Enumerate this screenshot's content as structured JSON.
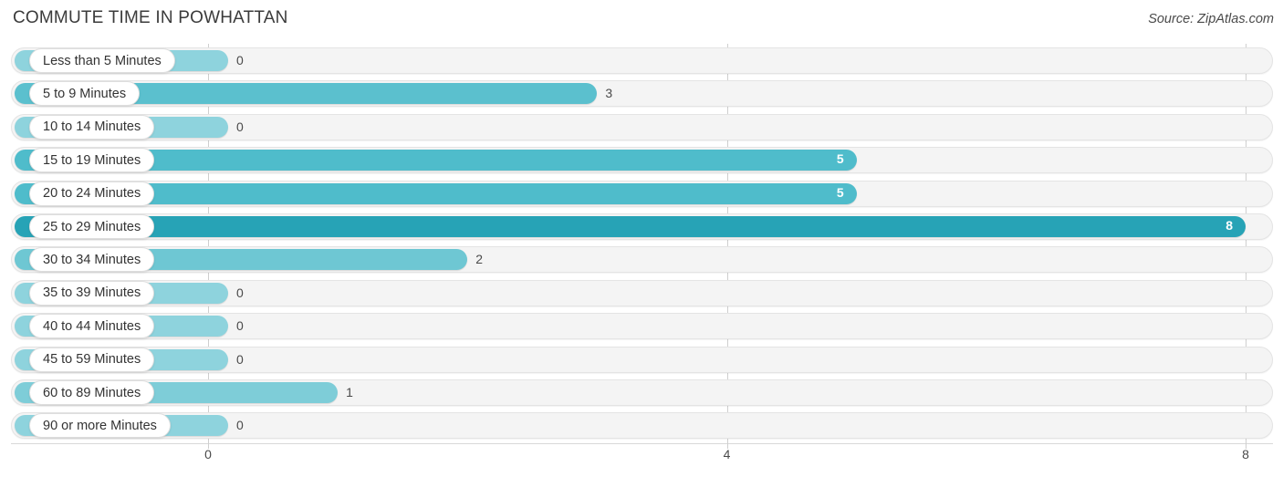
{
  "header": {
    "title": "COMMUTE TIME IN POWHATTAN",
    "source": "Source: ZipAtlas.com"
  },
  "chart_data": {
    "type": "bar",
    "orientation": "horizontal",
    "title": "COMMUTE TIME IN POWHATTAN",
    "xlabel": "",
    "ylabel": "",
    "xlim": [
      0,
      8
    ],
    "grid": true,
    "legend": "none",
    "xticks": [
      "0",
      "4",
      "8"
    ],
    "xtick_values": [
      0,
      4,
      8
    ],
    "categories": [
      "Less than 5 Minutes",
      "5 to 9 Minutes",
      "10 to 14 Minutes",
      "15 to 19 Minutes",
      "20 to 24 Minutes",
      "25 to 29 Minutes",
      "30 to 34 Minutes",
      "35 to 39 Minutes",
      "40 to 44 Minutes",
      "45 to 59 Minutes",
      "60 to 89 Minutes",
      "90 or more Minutes"
    ],
    "values": [
      0,
      3,
      0,
      5,
      5,
      8,
      2,
      0,
      0,
      0,
      1,
      0
    ],
    "value_labels": [
      "0",
      "3",
      "0",
      "5",
      "5",
      "8",
      "2",
      "0",
      "0",
      "0",
      "1",
      "0"
    ],
    "colors": {
      "zero": "#8ed3dd",
      "low": "#63c2d0",
      "mid": "#4fbccb",
      "high": "#27a3b6",
      "track": "#f4f4f4",
      "track_border": "#e4e4e4",
      "gridline": "#cfcfcf",
      "text": "#4a4a4a",
      "value_inside": "#ffffff"
    },
    "bars": [
      {
        "label": "Less than 5 Minutes",
        "value": 0,
        "value_label": "0",
        "color": "#8ed3dd",
        "inside": false
      },
      {
        "label": "5 to 9 Minutes",
        "value": 3,
        "value_label": "3",
        "color": "#5bc0ce",
        "inside": false
      },
      {
        "label": "10 to 14 Minutes",
        "value": 0,
        "value_label": "0",
        "color": "#8ed3dd",
        "inside": false
      },
      {
        "label": "15 to 19 Minutes",
        "value": 5,
        "value_label": "5",
        "color": "#4fbccb",
        "inside": true
      },
      {
        "label": "20 to 24 Minutes",
        "value": 5,
        "value_label": "5",
        "color": "#4fbccb",
        "inside": true
      },
      {
        "label": "25 to 29 Minutes",
        "value": 8,
        "value_label": "8",
        "color": "#27a3b6",
        "inside": true
      },
      {
        "label": "30 to 34 Minutes",
        "value": 2,
        "value_label": "2",
        "color": "#6ec7d3",
        "inside": false
      },
      {
        "label": "35 to 39 Minutes",
        "value": 0,
        "value_label": "0",
        "color": "#8ed3dd",
        "inside": false
      },
      {
        "label": "40 to 44 Minutes",
        "value": 0,
        "value_label": "0",
        "color": "#8ed3dd",
        "inside": false
      },
      {
        "label": "45 to 59 Minutes",
        "value": 0,
        "value_label": "0",
        "color": "#8ed3dd",
        "inside": false
      },
      {
        "label": "60 to 89 Minutes",
        "value": 1,
        "value_label": "1",
        "color": "#7ecdd8",
        "inside": false
      },
      {
        "label": "90 or more Minutes",
        "value": 0,
        "value_label": "0",
        "color": "#8ed3dd",
        "inside": false
      }
    ]
  }
}
